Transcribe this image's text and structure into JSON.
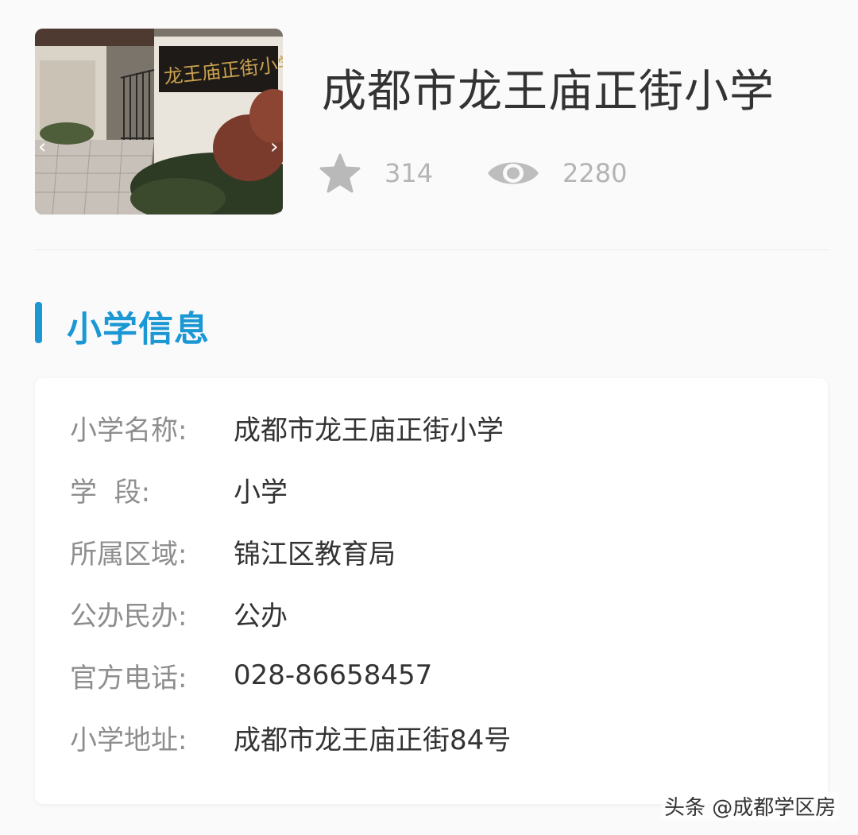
{
  "school_title": "成都市龙王庙正街小学",
  "photo": {
    "sign_text": "龙王庙正街小学",
    "prev_arrow": "‹",
    "next_arrow": "›"
  },
  "stats": {
    "favorites": "314",
    "views": "2280",
    "favorites_icon": "star-icon",
    "views_icon": "eye-icon"
  },
  "section": {
    "title": "小学信息",
    "accent_color": "#1b98d4"
  },
  "info_rows": [
    {
      "label": "小学名称:",
      "value": "成都市龙王庙正街小学"
    },
    {
      "label": "学  段:",
      "value": "小学"
    },
    {
      "label": "所属区域:",
      "value": "锦江区教育局"
    },
    {
      "label": "公办民办:",
      "value": "公办"
    },
    {
      "label": "官方电话:",
      "value": "028-86658457"
    },
    {
      "label": "小学地址:",
      "value": "成都市龙王庙正街84号"
    }
  ],
  "watermark": "头条 @成都学区房"
}
